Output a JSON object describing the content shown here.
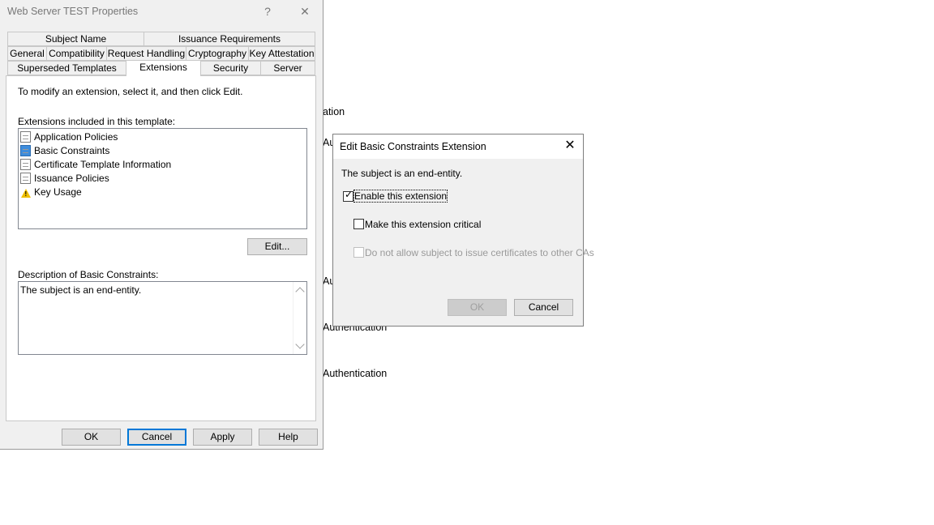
{
  "background_fragments": [
    "ation",
    "Au",
    "Au",
    "Authentication",
    "Authentication"
  ],
  "main_window": {
    "title": "Web Server TEST Properties",
    "help_glyph": "?",
    "close_glyph": "✕",
    "tabs_row1": [
      "Subject Name",
      "Issuance Requirements"
    ],
    "tabs_row2": [
      "General",
      "Compatibility",
      "Request Handling",
      "Cryptography",
      "Key Attestation"
    ],
    "tabs_row3": [
      "Superseded Templates",
      "Extensions",
      "Security",
      "Server"
    ],
    "active_tab": "Extensions",
    "instruction": "To modify an extension, select it, and then click Edit.",
    "list_label": "Extensions included in this template:",
    "extensions": [
      {
        "label": "Application Policies",
        "icon": "document-icon"
      },
      {
        "label": "Basic Constraints",
        "icon": "document-selected-icon"
      },
      {
        "label": "Certificate Template Information",
        "icon": "document-icon"
      },
      {
        "label": "Issuance Policies",
        "icon": "document-icon"
      },
      {
        "label": "Key Usage",
        "icon": "warning-icon"
      }
    ],
    "edit_button": "Edit...",
    "description_label": "Description of Basic Constraints:",
    "description_text": "The subject is an end-entity.",
    "buttons": {
      "ok": "OK",
      "cancel": "Cancel",
      "apply": "Apply",
      "help": "Help"
    }
  },
  "dialog": {
    "title": "Edit Basic Constraints Extension",
    "close_glyph": "✕",
    "subject_text": "The subject is an end-entity.",
    "enable_extension": {
      "label": "Enable this extension",
      "checked": true
    },
    "critical": {
      "label": "Make this extension critical",
      "checked": false
    },
    "no_ca": {
      "label": "Do not allow subject to issue certificates to other CAs",
      "checked": false,
      "disabled": true
    },
    "ok_label": "OK",
    "cancel_label": "Cancel"
  }
}
